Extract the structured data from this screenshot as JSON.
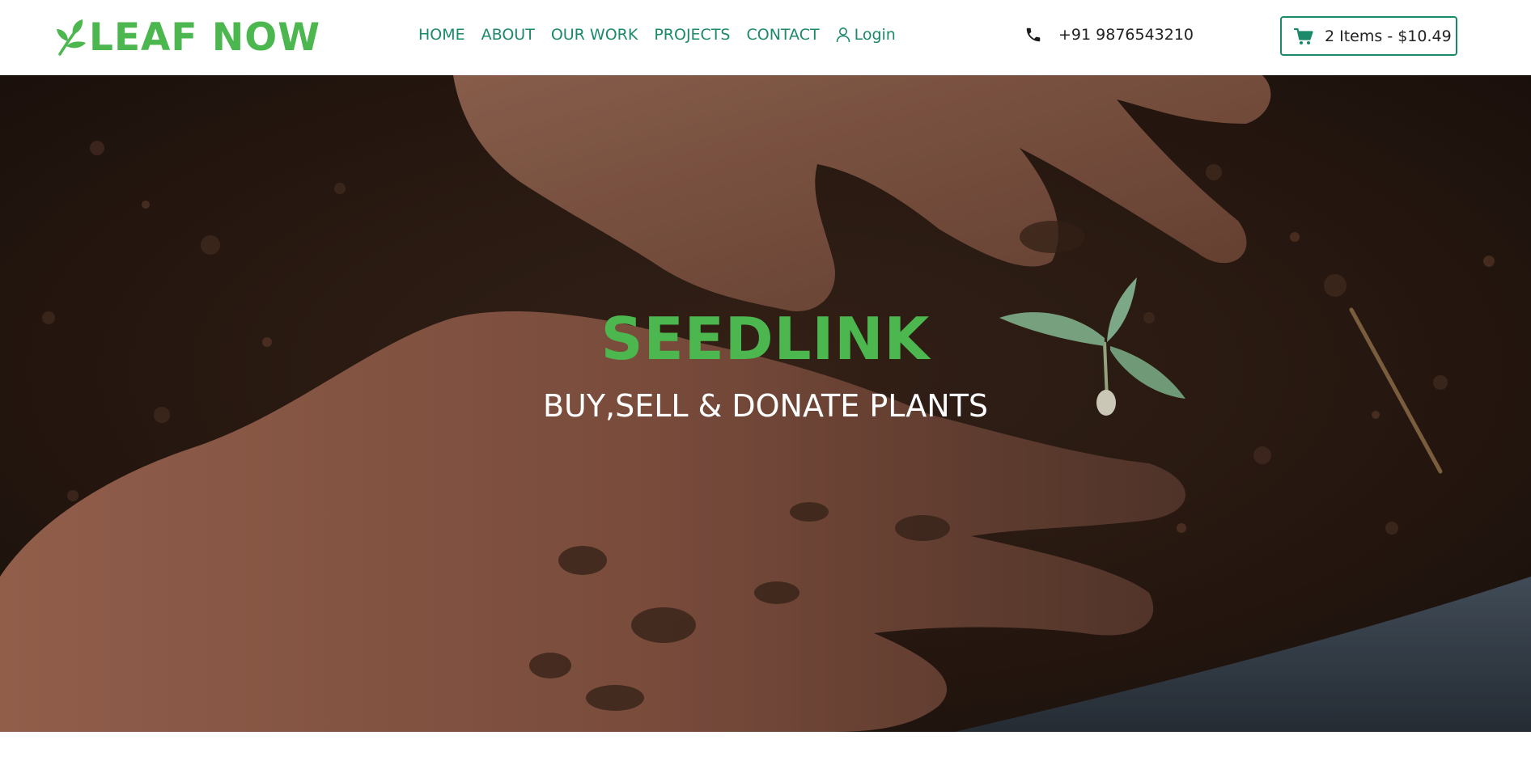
{
  "brand": {
    "name": "LEAF NOW",
    "color": "#4cb64f",
    "icon": "leaf-icon"
  },
  "nav": {
    "items": [
      {
        "label": "HOME"
      },
      {
        "label": "ABOUT"
      },
      {
        "label": "OUR WORK"
      },
      {
        "label": "PROJECTS"
      },
      {
        "label": "CONTACT"
      }
    ],
    "login_label": "Login",
    "login_icon": "user-icon",
    "link_color": "#1a8a6a"
  },
  "contact": {
    "phone": "+91 9876543210",
    "icon": "phone-icon"
  },
  "cart": {
    "label": "2 Items - $10.49",
    "icon": "cart-icon",
    "border_color": "#1a8a6a"
  },
  "hero": {
    "title": "SEEDLINK",
    "subtitle": "BUY,SELL & DONATE PLANTS",
    "title_color": "#4cb64f",
    "subtitle_color": "#ffffff",
    "image": "hands-planting-seedling-in-soil"
  }
}
